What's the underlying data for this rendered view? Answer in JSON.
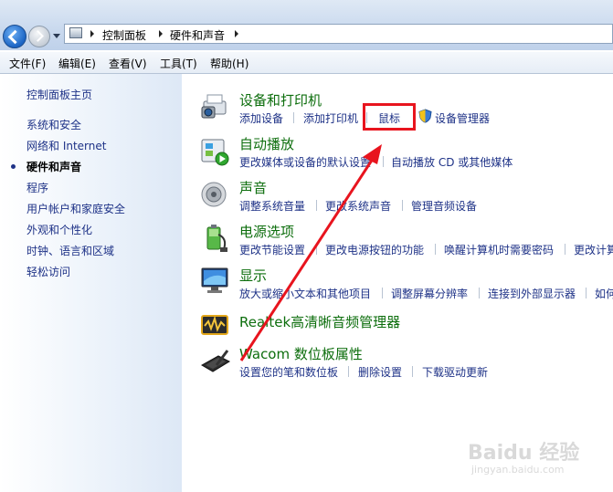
{
  "breadcrumb": {
    "root": "控制面板",
    "current": "硬件和声音"
  },
  "menu": [
    "文件(F)",
    "编辑(E)",
    "查看(V)",
    "工具(T)",
    "帮助(H)"
  ],
  "sidebar": {
    "home": "控制面板主页",
    "items": [
      "系统和安全",
      "网络和 Internet",
      "硬件和声音",
      "程序",
      "用户帐户和家庭安全",
      "外观和个性化",
      "时钟、语言和区域",
      "轻松访问"
    ]
  },
  "categories": {
    "devices": {
      "title": "设备和打印机",
      "links": [
        "添加设备",
        "添加打印机",
        "鼠标",
        "设备管理器"
      ]
    },
    "autoplay": {
      "title": "自动播放",
      "links": [
        "更改媒体或设备的默认设置",
        "自动播放 CD 或其他媒体"
      ]
    },
    "sound": {
      "title": "声音",
      "links": [
        "调整系统音量",
        "更改系统声音",
        "管理音频设备"
      ]
    },
    "power": {
      "title": "电源选项",
      "links": [
        "更改节能设置",
        "更改电源按钮的功能",
        "唤醒计算机时需要密码",
        "更改计算"
      ]
    },
    "display": {
      "title": "显示",
      "links": [
        "放大或缩小文本和其他项目",
        "调整屏幕分辨率",
        "连接到外部显示器",
        "如何"
      ]
    },
    "realtek": {
      "title": "Realtek高清晰音频管理器"
    },
    "wacom": {
      "title": "Wacom 数位板属性",
      "links": [
        "设置您的笔和数位板",
        "删除设置",
        "下载驱动更新"
      ]
    }
  },
  "watermark": {
    "brand": "Baidu 经验",
    "url": "jingyan.baidu.com"
  },
  "colors": {
    "accent_green": "#0d6e0d",
    "link_blue": "#1e3287",
    "highlight_red": "#e8141e"
  }
}
